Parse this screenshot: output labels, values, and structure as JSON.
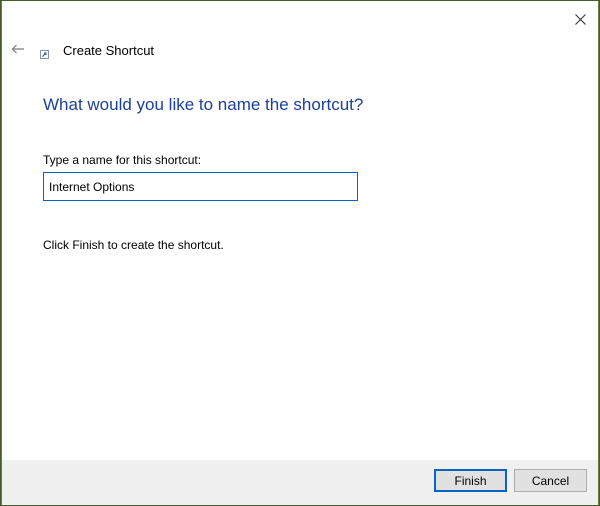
{
  "window": {
    "close_icon": "close-icon"
  },
  "header": {
    "back_icon": "back-arrow-icon",
    "app_icon": "shortcut-icon",
    "title": "Create Shortcut"
  },
  "main": {
    "heading": "What would you like to name the shortcut?",
    "field_label": "Type a name for this shortcut:",
    "name_value": "Internet Options",
    "info_text": "Click Finish to create the shortcut."
  },
  "footer": {
    "finish_label": "Finish",
    "cancel_label": "Cancel"
  },
  "colors": {
    "heading": "#1a3fa0",
    "accent": "#0a62c9",
    "footer_bg": "#f0f0f0"
  }
}
